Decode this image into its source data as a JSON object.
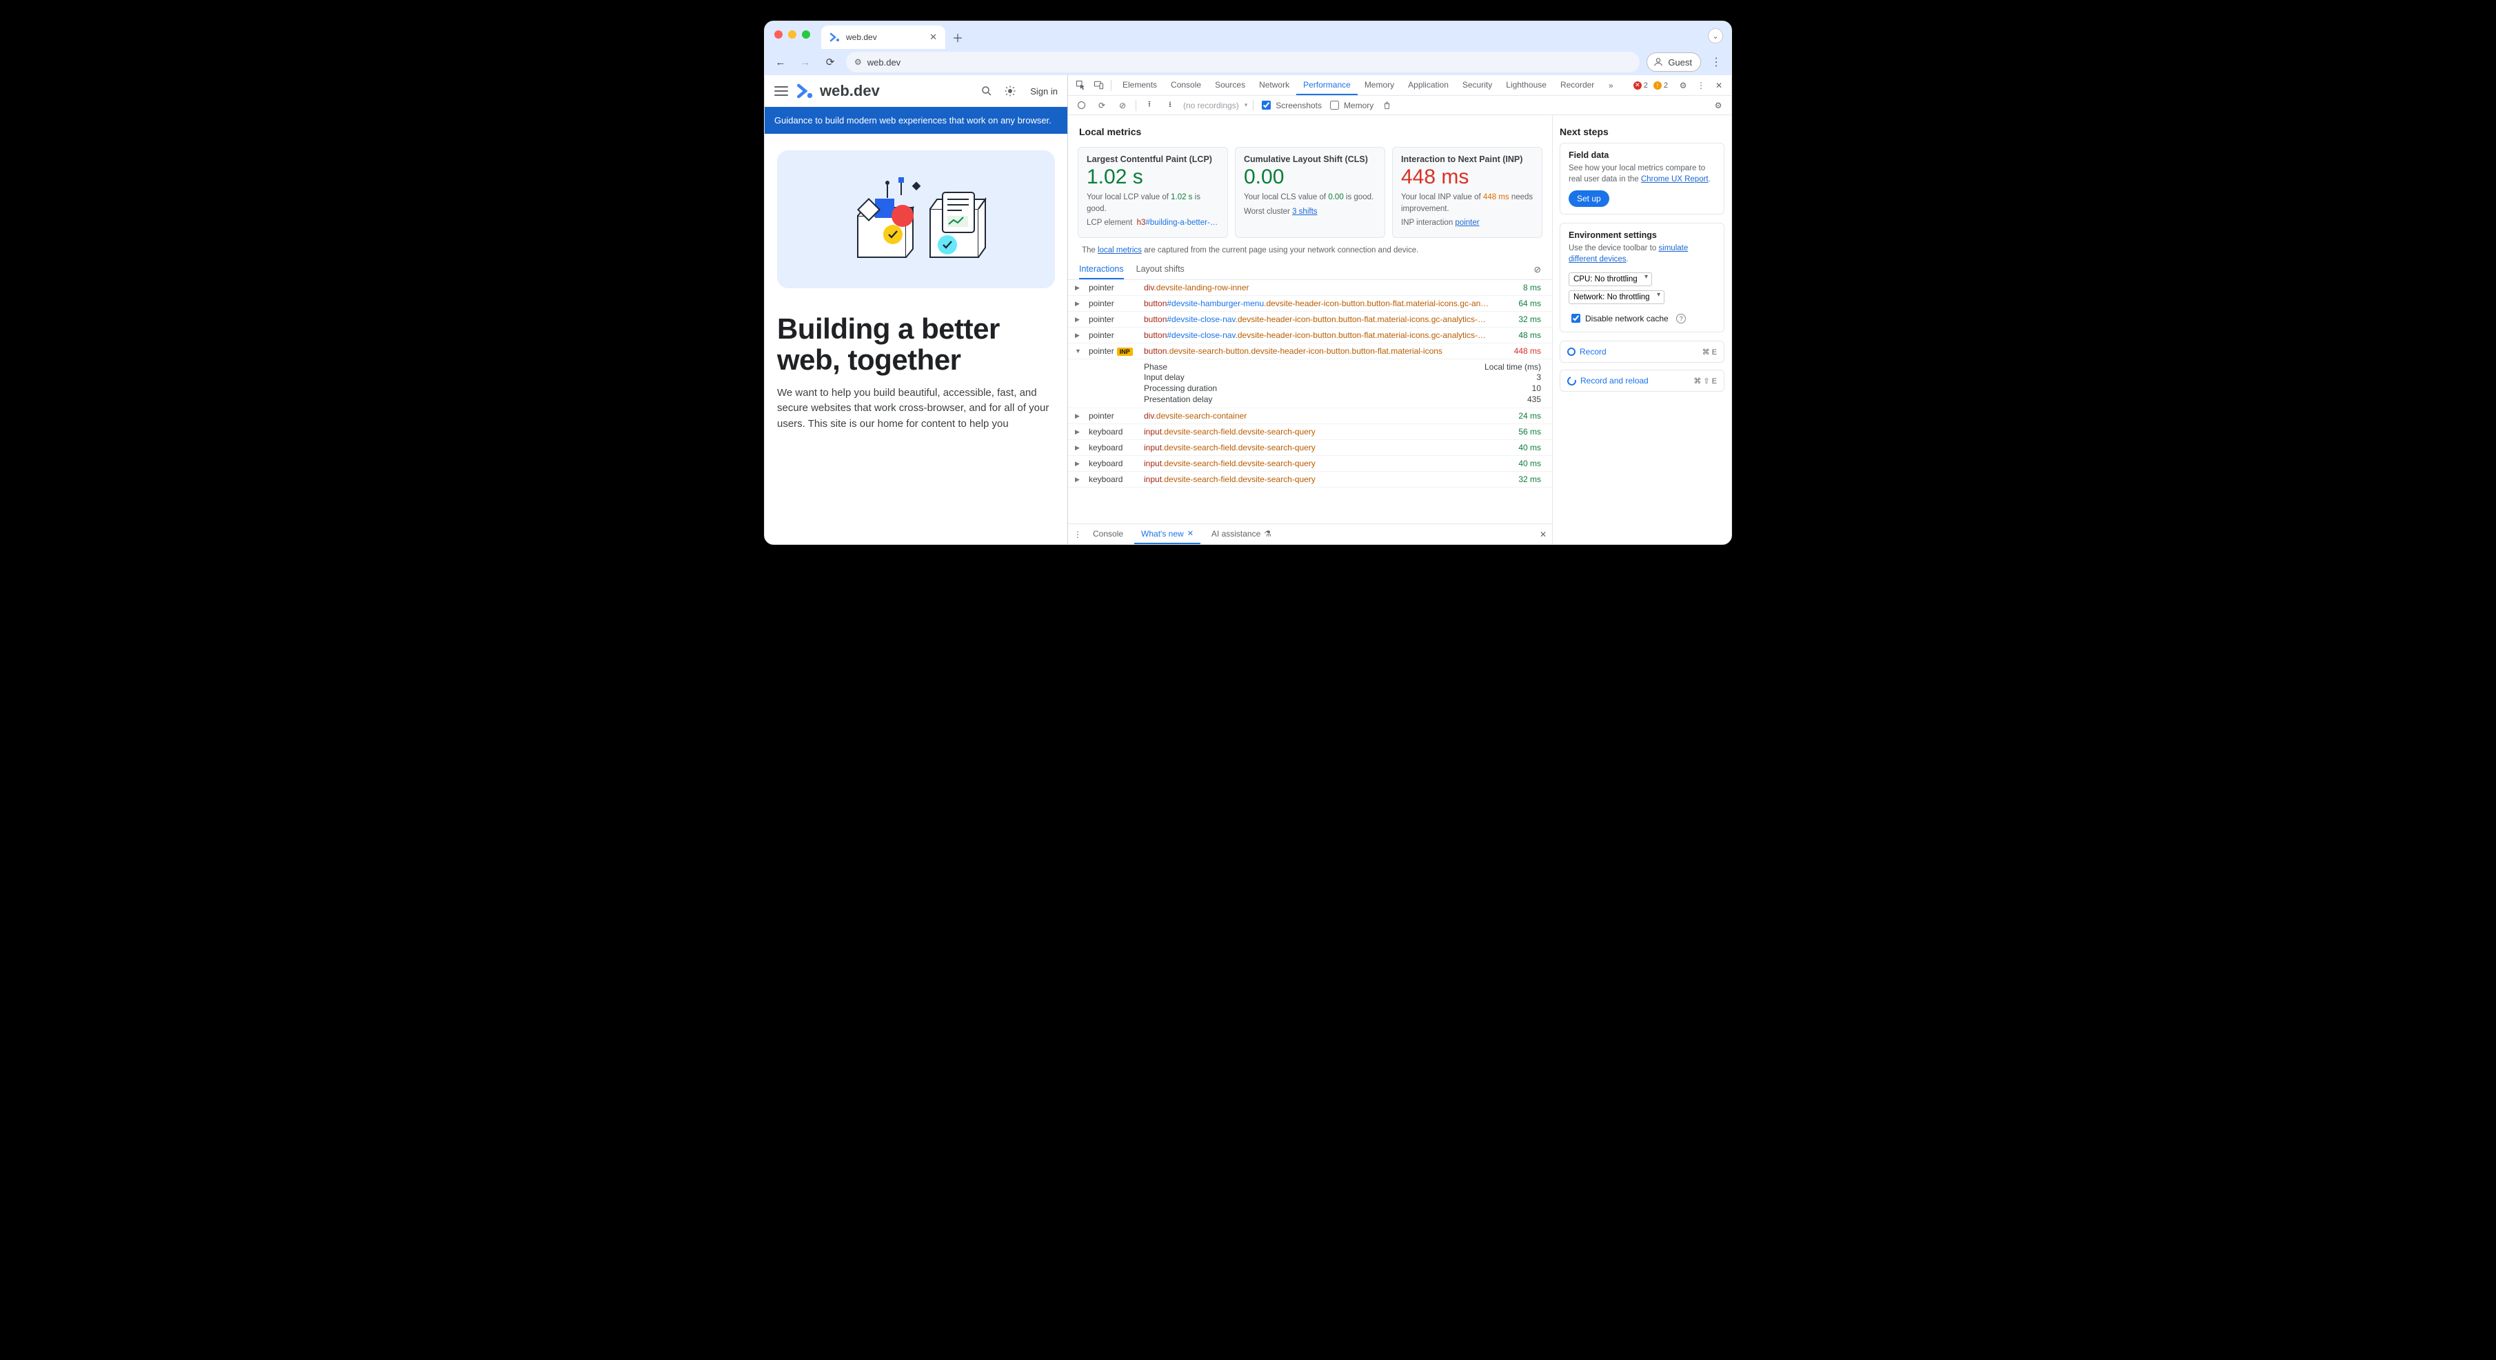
{
  "browser": {
    "tab_title": "web.dev",
    "url": "web.dev",
    "guest_label": "Guest"
  },
  "page": {
    "brand": "web.dev",
    "signin": "Sign in",
    "ribbon": "Guidance to build modern web experiences that work on any browser.",
    "hero_title": "Building a better web, together",
    "hero_body": "We want to help you build beautiful, accessible, fast, and secure websites that work cross-browser, and for all of your users. This site is our home for content to help you"
  },
  "devtools": {
    "tabs": [
      "Elements",
      "Console",
      "Sources",
      "Network",
      "Performance",
      "Memory",
      "Application",
      "Security",
      "Lighthouse",
      "Recorder"
    ],
    "active_tab": "Performance",
    "error_count": "2",
    "warn_count": "2",
    "sub": {
      "dropdown": "(no recordings)",
      "screenshots_label": "Screenshots",
      "memory_label": "Memory"
    },
    "local_metrics_title": "Local metrics",
    "metrics": {
      "lcp": {
        "title": "Largest Contentful Paint (LCP)",
        "value": "1.02 s",
        "desc_pre": "Your local LCP value of ",
        "desc_val": "1.02 s",
        "desc_post": " is good.",
        "extra_label": "LCP element",
        "extra_tag": "h3",
        "extra_sel": "#building-a-better-…"
      },
      "cls": {
        "title": "Cumulative Layout Shift (CLS)",
        "value": "0.00",
        "desc_pre": "Your local CLS value of ",
        "desc_val": "0.00",
        "desc_post": " is good.",
        "extra_label": "Worst cluster",
        "extra_link": "3 shifts"
      },
      "inp": {
        "title": "Interaction to Next Paint (INP)",
        "value": "448 ms",
        "desc_pre": "Your local INP value of ",
        "desc_val": "448 ms",
        "desc_post": " needs improvement.",
        "extra_label": "INP interaction",
        "extra_link": "pointer"
      }
    },
    "note_pre": "The ",
    "note_link": "local metrics",
    "note_post": " are captured from the current page using your network connection and device.",
    "int_tabs": {
      "a": "Interactions",
      "b": "Layout shifts"
    },
    "phase": {
      "head_a": "Phase",
      "head_b": "Local time (ms)",
      "r1a": "Input delay",
      "r1b": "3",
      "r2a": "Processing duration",
      "r2b": "10",
      "r3a": "Presentation delay",
      "r3b": "435"
    },
    "rows": [
      {
        "ev": "pointer",
        "el": "div",
        "id": "",
        "cls": ".devsite-landing-row-inner",
        "dur": "8 ms",
        "bad": false,
        "open": false,
        "inp": false
      },
      {
        "ev": "pointer",
        "el": "button",
        "id": "#devsite-hamburger-menu",
        "cls": ".devsite-header-icon-button.button-flat.material-icons.gc-an…",
        "dur": "64 ms",
        "bad": false,
        "open": false,
        "inp": false
      },
      {
        "ev": "pointer",
        "el": "button",
        "id": "#devsite-close-nav",
        "cls": ".devsite-header-icon-button.button-flat.material-icons.gc-analytics-…",
        "dur": "32 ms",
        "bad": false,
        "open": false,
        "inp": false
      },
      {
        "ev": "pointer",
        "el": "button",
        "id": "#devsite-close-nav",
        "cls": ".devsite-header-icon-button.button-flat.material-icons.gc-analytics-…",
        "dur": "48 ms",
        "bad": false,
        "open": false,
        "inp": false
      },
      {
        "ev": "pointer",
        "el": "button",
        "id": "",
        "cls": ".devsite-search-button.devsite-header-icon-button.button-flat.material-icons",
        "dur": "448 ms",
        "bad": true,
        "open": true,
        "inp": true
      },
      {
        "ev": "pointer",
        "el": "div",
        "id": "",
        "cls": ".devsite-search-container",
        "dur": "24 ms",
        "bad": false,
        "open": false,
        "inp": false
      },
      {
        "ev": "keyboard",
        "el": "input",
        "id": "",
        "cls": ".devsite-search-field.devsite-search-query",
        "dur": "56 ms",
        "bad": false,
        "open": false,
        "inp": false
      },
      {
        "ev": "keyboard",
        "el": "input",
        "id": "",
        "cls": ".devsite-search-field.devsite-search-query",
        "dur": "40 ms",
        "bad": false,
        "open": false,
        "inp": false
      },
      {
        "ev": "keyboard",
        "el": "input",
        "id": "",
        "cls": ".devsite-search-field.devsite-search-query",
        "dur": "40 ms",
        "bad": false,
        "open": false,
        "inp": false
      },
      {
        "ev": "keyboard",
        "el": "input",
        "id": "",
        "cls": ".devsite-search-field.devsite-search-query",
        "dur": "32 ms",
        "bad": false,
        "open": false,
        "inp": false
      }
    ],
    "drawer": {
      "console": "Console",
      "whatsnew": "What's new",
      "ai": "AI assistance"
    }
  },
  "sidebar": {
    "next_steps": "Next steps",
    "field": {
      "title": "Field data",
      "desc": "See how your local metrics compare to real user data in the ",
      "link": "Chrome UX Report",
      "button": "Set up"
    },
    "env": {
      "title": "Environment settings",
      "desc": "Use the device toolbar to ",
      "link": "simulate different devices",
      "cpu": "CPU: No throttling",
      "net": "Network: No throttling",
      "cache": "Disable network cache"
    },
    "record": "Record",
    "record_kbd": "⌘ E",
    "rr": "Record and reload",
    "rr_kbd": "⌘ ⇧ E"
  }
}
